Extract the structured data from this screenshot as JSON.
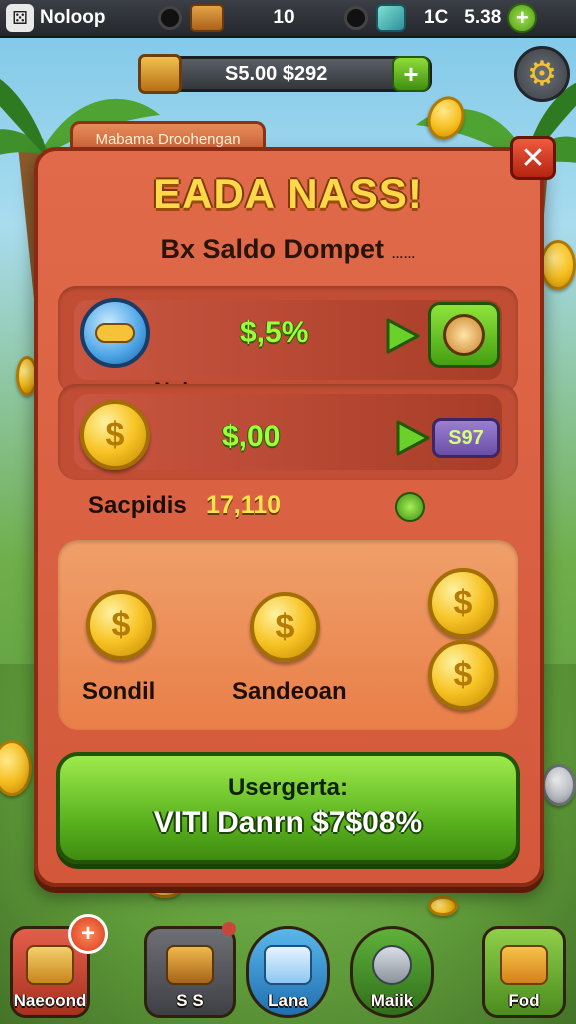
{
  "topbar": {
    "name": "Noloop",
    "level": "10",
    "time": "1C",
    "cash": "5.38",
    "plus_symbol": "+"
  },
  "balance": {
    "text": "S5.00 $292",
    "plus_symbol": "+"
  },
  "modal": {
    "tab_label": "Mabama Droohengan",
    "title": "EADA NASS!",
    "subtitle": "Bx Saldo Dompet",
    "subtitle_small": "……",
    "close_symbol": "✕",
    "rows": [
      {
        "value": "$,5%",
        "icon": "token-icon"
      },
      {
        "label_above": "Naluper.",
        "value": "$,00",
        "count": "S97",
        "icon": "coin-icon"
      }
    ],
    "stat": {
      "label": "Sacpidis",
      "value": "17,110"
    },
    "coins": [
      {
        "caption": "Sondil"
      },
      {
        "caption": "Sandeoan"
      }
    ],
    "coin_symbol": "$",
    "cta": {
      "top_text": "Usergerta:",
      "main_text": "VITI Danrn $7$08%"
    }
  },
  "nav": {
    "items": [
      {
        "label": "Naeoond",
        "badge": "+"
      },
      {
        "label": "S S",
        "badge": ""
      },
      {
        "label": "Lana",
        "badge": ""
      },
      {
        "label": "Maiik",
        "badge": ""
      },
      {
        "label": "Fod",
        "badge": ""
      }
    ]
  },
  "colors": {
    "modal_bg": "#d3583b",
    "title_gold": "#ffd84a",
    "value_green": "#9dff3a",
    "cta_green": "#58b01d"
  }
}
